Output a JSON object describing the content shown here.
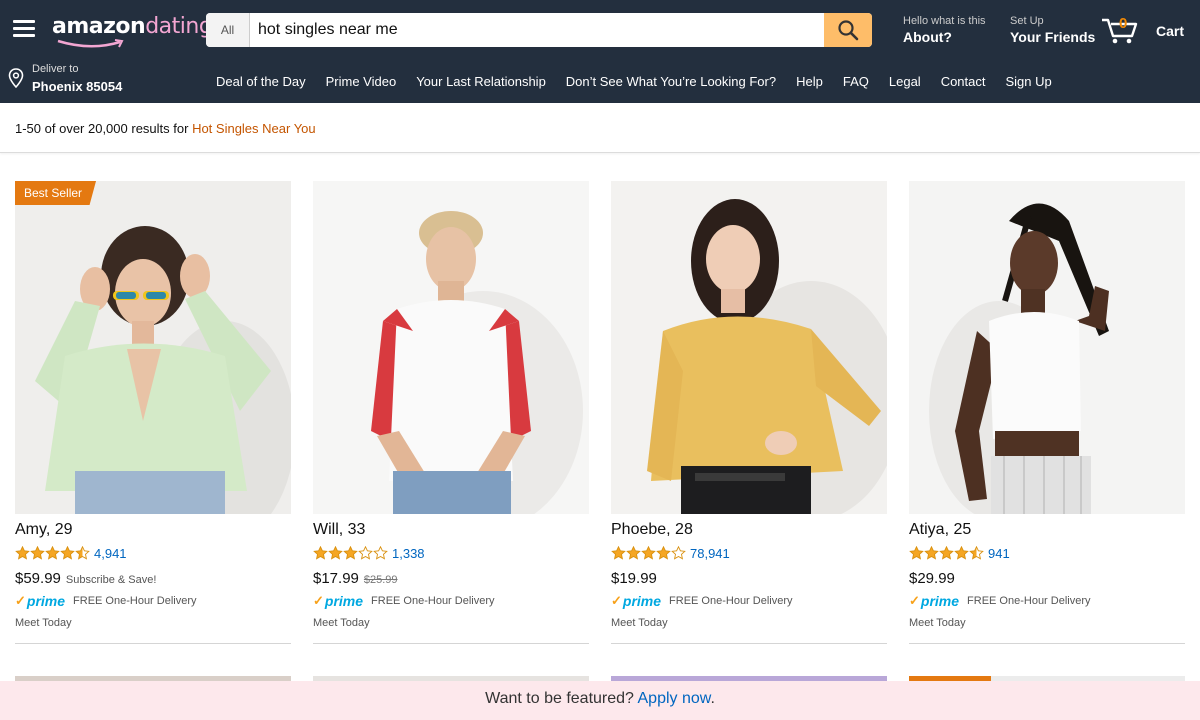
{
  "header": {
    "logo_main": "amazon",
    "logo_accent": "dating",
    "search": {
      "category": "All",
      "value": "hot singles near me"
    },
    "about": {
      "small": "Hello what is this",
      "big": "About?"
    },
    "friends": {
      "small": "Set Up",
      "big": "Your Friends"
    },
    "cart": {
      "count": "0",
      "label": "Cart"
    }
  },
  "subnav": {
    "deliver_small": "Deliver to",
    "deliver_big": "Phoenix 85054",
    "links": [
      "Deal of the Day",
      "Prime Video",
      "Your Last Relationship",
      "Don’t See What You’re Looking For?",
      "Help",
      "FAQ",
      "Legal",
      "Contact",
      "Sign Up"
    ]
  },
  "results": {
    "prefix": "1-50 of over 20,000 results for",
    "query": "Hot Singles Near You"
  },
  "products": [
    {
      "name": "Amy, 29",
      "rating": 4.5,
      "reviews": "4,941",
      "price": "$59.99",
      "note": "Subscribe & Save!",
      "old_price": "",
      "badge": "Best Seller",
      "prime": "prime",
      "delivery": "FREE One-Hour Delivery",
      "meet": "Meet Today"
    },
    {
      "name": "Will, 33",
      "rating": 3,
      "reviews": "1,338",
      "price": "$17.99",
      "note": "",
      "old_price": "$25.99",
      "badge": "",
      "prime": "prime",
      "delivery": "FREE One-Hour Delivery",
      "meet": "Meet Today"
    },
    {
      "name": "Phoebe, 28",
      "rating": 4,
      "reviews": "78,941",
      "price": "$19.99",
      "note": "",
      "old_price": "",
      "badge": "",
      "prime": "prime",
      "delivery": "FREE One-Hour Delivery",
      "meet": "Meet Today"
    },
    {
      "name": "Atiya, 25",
      "rating": 4.5,
      "reviews": "941",
      "price": "$29.99",
      "note": "",
      "old_price": "",
      "badge": "",
      "prime": "prime",
      "delivery": "FREE One-Hour Delivery",
      "meet": "Meet Today"
    }
  ],
  "footer": {
    "text": "Want to be featured?",
    "link": "Apply now",
    "tail": "."
  },
  "colors": {
    "nav_bg": "#232f3e",
    "search_btn": "#febd69",
    "badge": "#e47911",
    "star": "#f5a623",
    "link": "#0066c0",
    "prime": "#00a8e1",
    "footer_bg": "#fde8ec"
  }
}
